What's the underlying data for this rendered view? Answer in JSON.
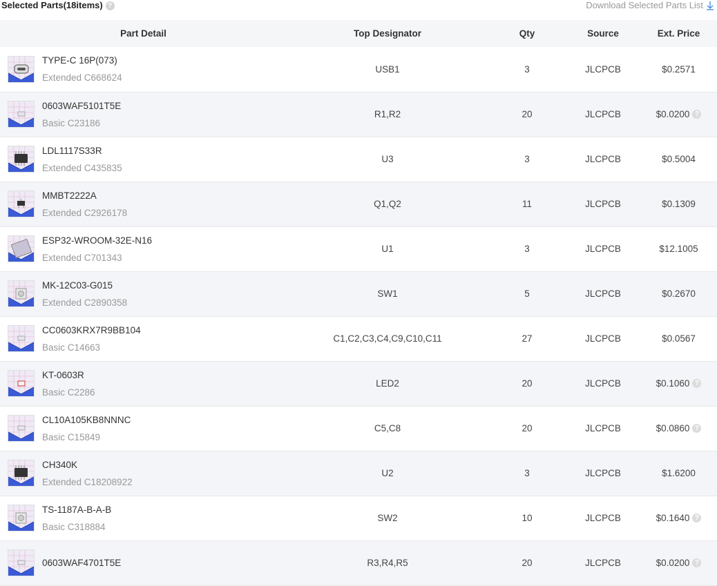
{
  "header": {
    "title": "Selected Parts(18items)",
    "download_label": "Download Selected Parts List"
  },
  "columns": [
    "Part Detail",
    "Top Designator",
    "Qty",
    "Source",
    "Ext. Price"
  ],
  "colors": {
    "accent": "#4a90e2",
    "header_bg": "#f5f6f8",
    "alt_row_bg": "#f4f5f8",
    "muted_text": "#999999"
  },
  "rows": [
    {
      "name": "TYPE-C 16P(073)",
      "sub": "Extended C668624",
      "designator": "USB1",
      "qty": "3",
      "source": "JLCPCB",
      "price": "$0.2571",
      "help": false,
      "icon": "usb-c-connector-icon"
    },
    {
      "name": "0603WAF5101T5E",
      "sub": "Basic C23186",
      "designator": "R1,R2",
      "qty": "20",
      "source": "JLCPCB",
      "price": "$0.0200",
      "help": true,
      "icon": "resistor-icon"
    },
    {
      "name": "LDL1117S33R",
      "sub": "Extended C435835",
      "designator": "U3",
      "qty": "3",
      "source": "JLCPCB",
      "price": "$0.5004",
      "help": false,
      "icon": "regulator-icon"
    },
    {
      "name": "MMBT2222A",
      "sub": "Extended C2926178",
      "designator": "Q1,Q2",
      "qty": "11",
      "source": "JLCPCB",
      "price": "$0.1309",
      "help": false,
      "icon": "transistor-icon"
    },
    {
      "name": "ESP32-WROOM-32E-N16",
      "sub": "Extended C701343",
      "designator": "U1",
      "qty": "3",
      "source": "JLCPCB",
      "price": "$12.1005",
      "help": false,
      "icon": "module-icon"
    },
    {
      "name": "MK-12C03-G015",
      "sub": "Extended C2890358",
      "designator": "SW1",
      "qty": "5",
      "source": "JLCPCB",
      "price": "$0.2670",
      "help": false,
      "icon": "switch-icon"
    },
    {
      "name": "CC0603KRX7R9BB104",
      "sub": "Basic C14663",
      "designator": "C1,C2,C3,C4,C9,C10,C11",
      "qty": "27",
      "source": "JLCPCB",
      "price": "$0.0567",
      "help": false,
      "icon": "capacitor-icon"
    },
    {
      "name": "KT-0603R",
      "sub": "Basic C2286",
      "designator": "LED2",
      "qty": "20",
      "source": "JLCPCB",
      "price": "$0.1060",
      "help": true,
      "icon": "led-icon"
    },
    {
      "name": "CL10A105KB8NNNC",
      "sub": "Basic C15849",
      "designator": "C5,C8",
      "qty": "20",
      "source": "JLCPCB",
      "price": "$0.0860",
      "help": true,
      "icon": "capacitor-icon"
    },
    {
      "name": "CH340K",
      "sub": "Extended C18208922",
      "designator": "U2",
      "qty": "3",
      "source": "JLCPCB",
      "price": "$1.6200",
      "help": false,
      "icon": "ic-chip-icon"
    },
    {
      "name": "TS-1187A-B-A-B",
      "sub": "Basic C318884",
      "designator": "SW2",
      "qty": "10",
      "source": "JLCPCB",
      "price": "$0.1640",
      "help": true,
      "icon": "tact-switch-icon"
    },
    {
      "name": "0603WAF4701T5E",
      "sub": "",
      "designator": "R3,R4,R5",
      "qty": "20",
      "source": "JLCPCB",
      "price": "$0.0200",
      "help": true,
      "icon": "resistor-icon"
    }
  ]
}
